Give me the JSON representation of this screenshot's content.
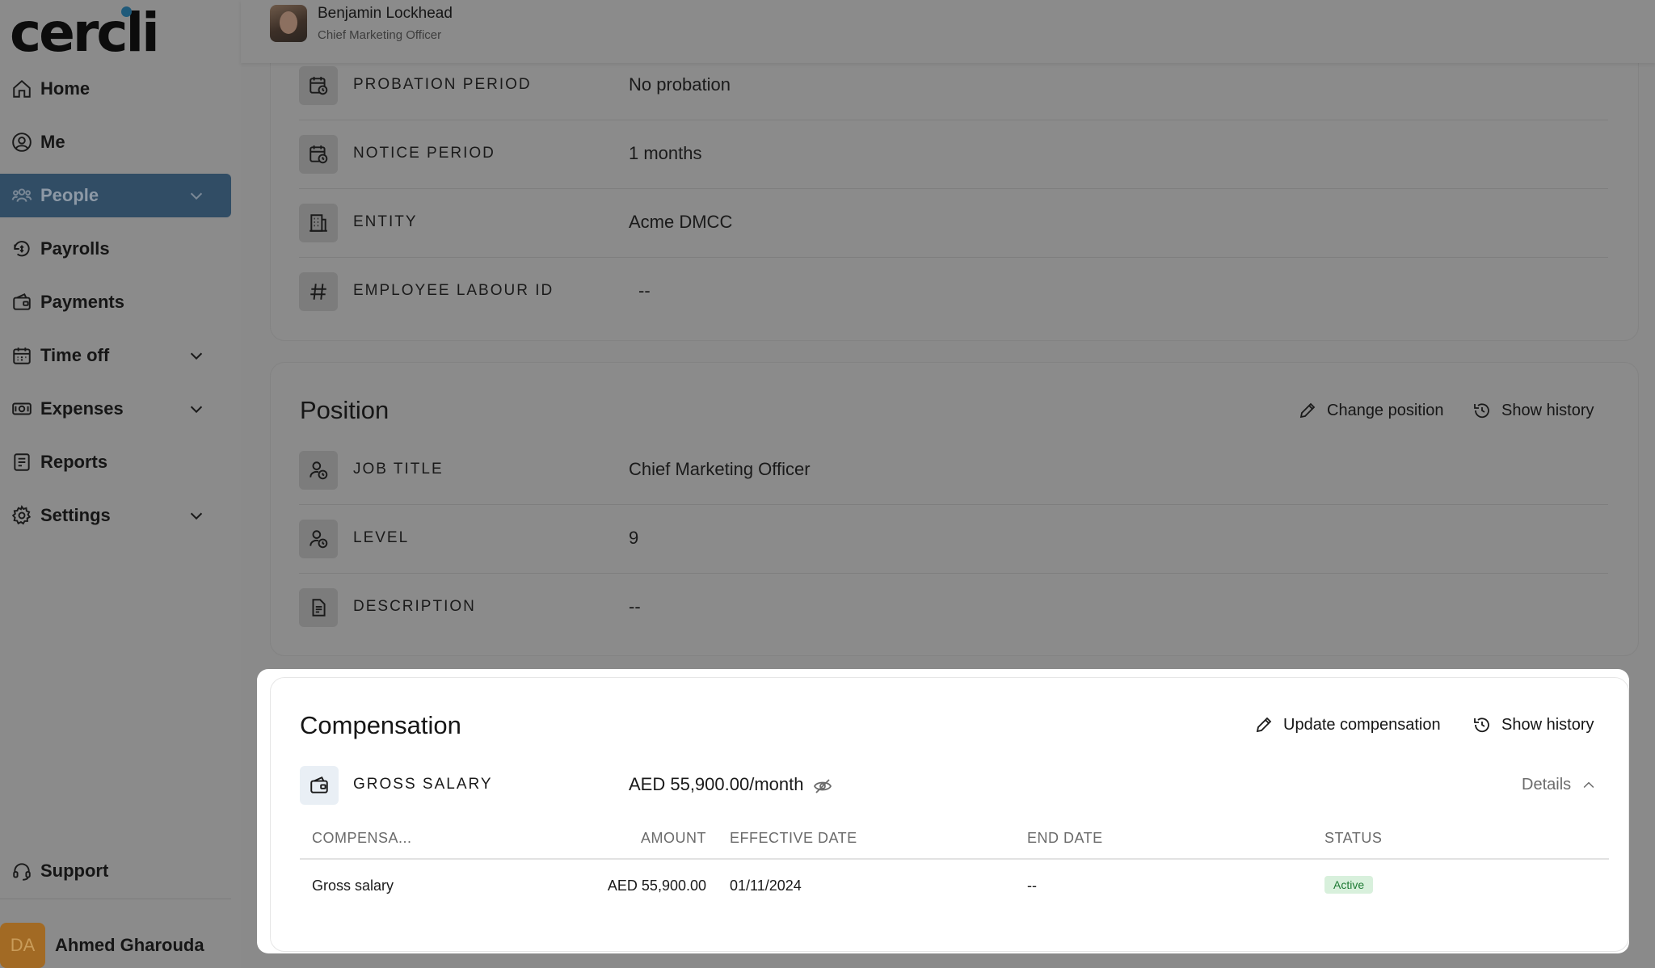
{
  "sidebar": {
    "logo": "cercli",
    "items": [
      {
        "label": "Home",
        "icon": "home-icon"
      },
      {
        "label": "Me",
        "icon": "user-circle-icon"
      },
      {
        "label": "People",
        "icon": "people-icon",
        "active": true
      },
      {
        "label": "Payrolls",
        "icon": "payroll-icon"
      },
      {
        "label": "Payments",
        "icon": "wallet-icon"
      },
      {
        "label": "Time off",
        "icon": "calendar-icon"
      },
      {
        "label": "Expenses",
        "icon": "expenses-icon"
      },
      {
        "label": "Reports",
        "icon": "reports-icon"
      },
      {
        "label": "Settings",
        "icon": "gear-icon"
      }
    ],
    "support": "Support",
    "user": {
      "initials": "DA",
      "name": "Ahmed Gharouda"
    }
  },
  "header": {
    "name": "Benjamin Lockhead",
    "role": "Chief Marketing Officer"
  },
  "contract": {
    "rows": [
      {
        "label": "PROBATION PERIOD",
        "value": "No probation",
        "icon": "calendar-clock-icon"
      },
      {
        "label": "NOTICE PERIOD",
        "value": "1 months",
        "icon": "calendar-clock-icon"
      },
      {
        "label": "ENTITY",
        "value": "Acme DMCC",
        "icon": "building-icon"
      },
      {
        "label": "EMPLOYEE LABOUR ID",
        "value": "--",
        "icon": "hash-icon"
      }
    ]
  },
  "position": {
    "title": "Position",
    "change_label": "Change position",
    "history_label": "Show history",
    "rows": [
      {
        "label": "JOB TITLE",
        "value": "Chief Marketing Officer",
        "icon": "user-clock-icon"
      },
      {
        "label": "LEVEL",
        "value": "9",
        "icon": "user-clock-icon"
      },
      {
        "label": "DESCRIPTION",
        "value": "--",
        "icon": "document-icon"
      }
    ]
  },
  "compensation": {
    "title": "Compensation",
    "update_label": "Update compensation",
    "history_label": "Show history",
    "gross_label": "GROSS SALARY",
    "gross_value": "AED 55,900.00/month",
    "details_label": "Details",
    "table": {
      "headers": [
        "COMPENSA...",
        "AMOUNT",
        "EFFECTIVE DATE",
        "END DATE",
        "STATUS"
      ],
      "rows": [
        {
          "type": "Gross salary",
          "amount": "AED 55,900.00",
          "effective": "01/11/2024",
          "end": "--",
          "status": "Active"
        }
      ]
    },
    "status_color": "#1e7a34"
  },
  "colors": {
    "accent": "#314d65",
    "overlay": "#8b8b8b",
    "active_badge_bg": "#d8f0dc"
  }
}
